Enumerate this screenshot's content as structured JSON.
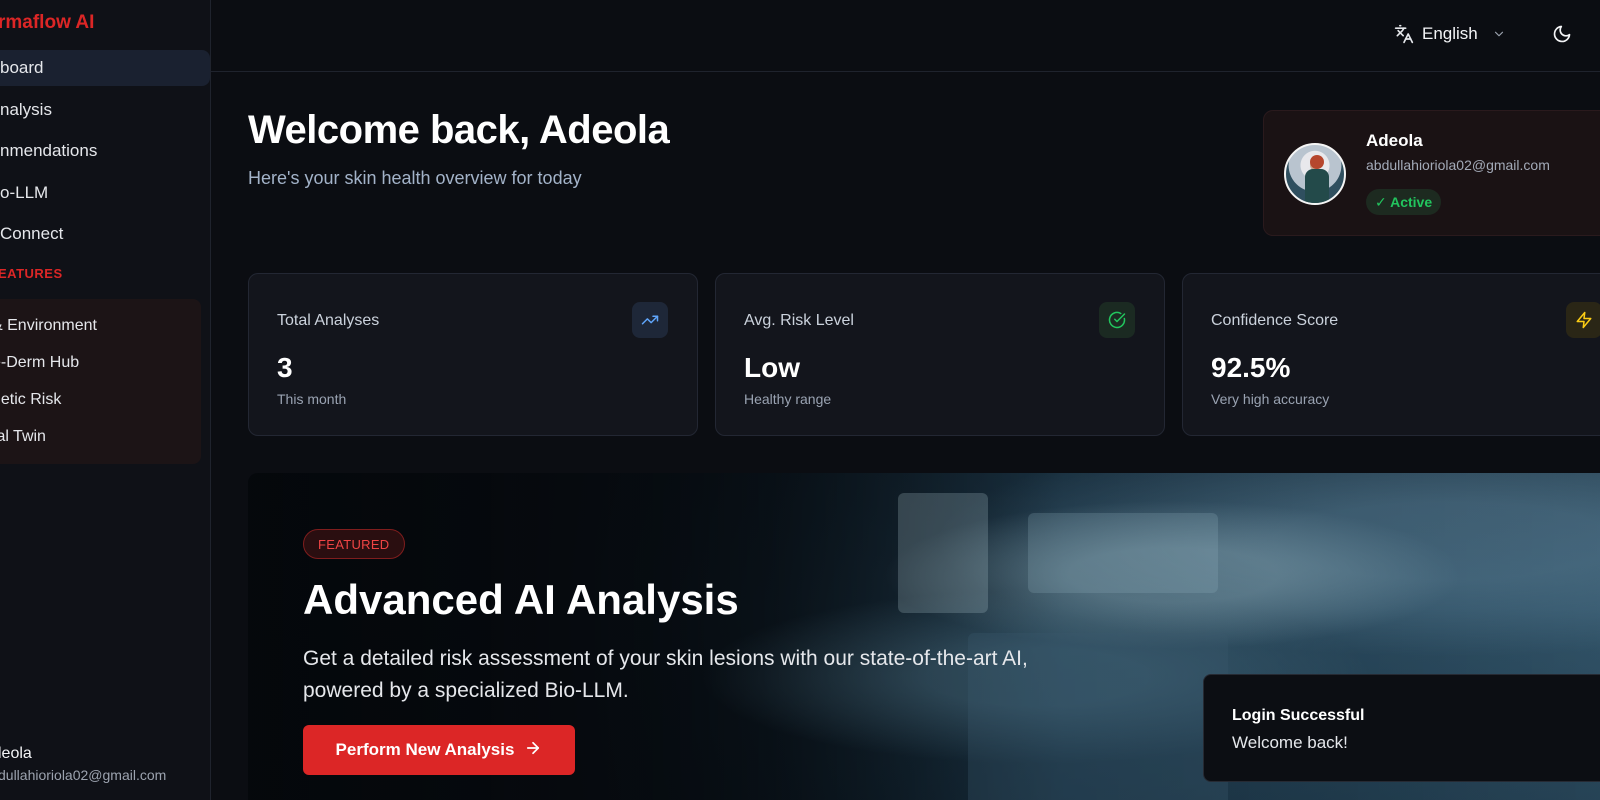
{
  "sidebar": {
    "brand": "rmaflow AI",
    "nav": [
      {
        "label": "board"
      },
      {
        "label": "nalysis"
      },
      {
        "label": "nmendations"
      },
      {
        "label": "o-LLM"
      },
      {
        "label": "Connect"
      }
    ],
    "section_label": "EATURES",
    "features": [
      {
        "label": "& Environment"
      },
      {
        "label": "e-Derm Hub"
      },
      {
        "label": "netic Risk"
      },
      {
        "label": "tal Twin"
      }
    ],
    "user_name": "leola",
    "user_email": "dullahioriola02@gmail.com"
  },
  "topbar": {
    "language": "English"
  },
  "welcome": {
    "title": "Welcome back, Adeola",
    "subtitle": "Here's your skin health overview for today"
  },
  "profile": {
    "name": "Adeola",
    "email": "abdullahioriola02@gmail.com",
    "status": "✓ Active"
  },
  "stats": [
    {
      "label": "Total Analyses",
      "value": "3",
      "note": "This month",
      "icon": "trending-up-icon",
      "color": "#60a5fa"
    },
    {
      "label": "Avg. Risk Level",
      "value": "Low",
      "note": "Healthy range",
      "icon": "check-circle-icon",
      "color": "#22c55e"
    },
    {
      "label": "Confidence Score",
      "value": "92.5%",
      "note": "Very high accuracy",
      "icon": "lightning-icon",
      "color": "#facc15"
    }
  ],
  "banner": {
    "tag": "FEATURED",
    "title": "Advanced AI Analysis",
    "description": "Get a detailed risk assessment of your skin lesions with our state-of-the-art AI, powered by a specialized Bio-LLM.",
    "cta": "Perform New Analysis"
  },
  "toast": {
    "title": "Login Successful",
    "message": "Welcome back!"
  },
  "colors": {
    "accent": "#dc2626",
    "success": "#22c55e"
  }
}
